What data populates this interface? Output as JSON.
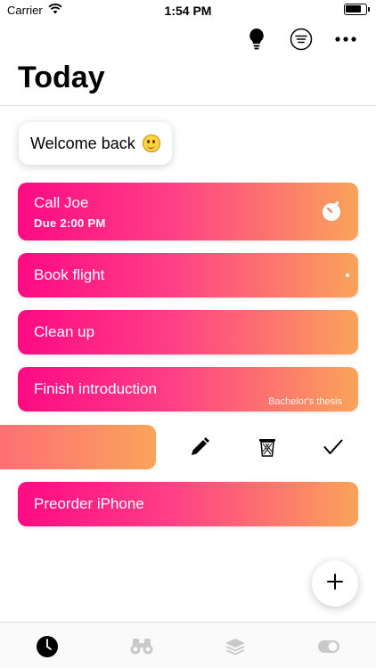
{
  "status_bar": {
    "carrier": "Carrier",
    "time": "1:54 PM",
    "battery_level": 0.8,
    "icons": [
      "wifi-icon",
      "battery-icon"
    ]
  },
  "toolbar": {
    "icons": [
      "lightbulb-icon",
      "filter-icon",
      "more-icon"
    ]
  },
  "page": {
    "title": "Today"
  },
  "welcome": {
    "text": "Welcome back",
    "emoji": "smiley-emoji-icon"
  },
  "tasks": [
    {
      "title": "Call Joe",
      "due": "Due 2:00 PM",
      "icon": "timer-icon"
    },
    {
      "title": "Book flight",
      "icon": "dot-indicator"
    },
    {
      "title": "Clean up"
    },
    {
      "title": "Finish introduction",
      "tag": "Bachelor's thesis"
    },
    {
      "title": "",
      "swiped": true
    },
    {
      "title": "Preorder iPhone"
    }
  ],
  "swipe_actions": [
    "edit-pencil-icon",
    "delete-trash-icon",
    "complete-check-icon"
  ],
  "fab": {
    "icon": "plus-icon"
  },
  "tabbar": {
    "tabs": [
      "clock-icon",
      "binoculars-icon",
      "layers-icon",
      "toggle-icon"
    ],
    "active_index": 0
  },
  "colors": {
    "gradient_start": "#ff0a84",
    "gradient_end": "#f9a45a",
    "text": "#000000"
  }
}
